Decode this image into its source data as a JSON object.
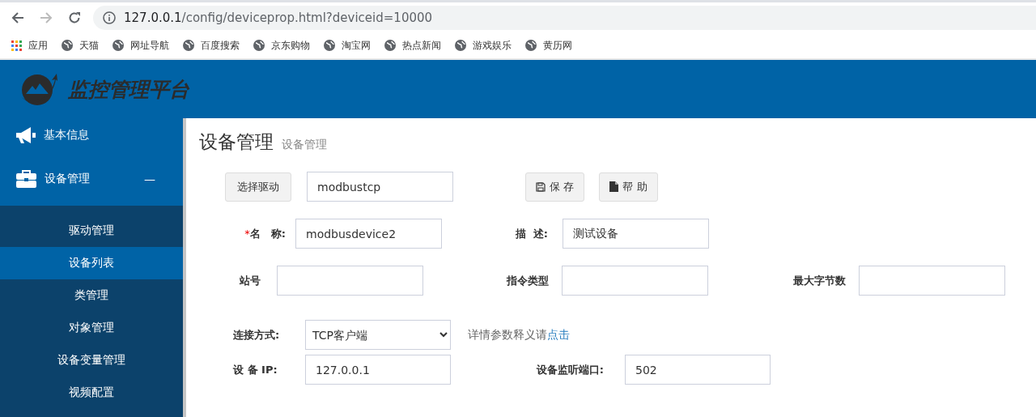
{
  "browser": {
    "nav_buttons": [
      {
        "kind": "back",
        "disabled": false
      },
      {
        "kind": "forward",
        "disabled": true
      },
      {
        "kind": "reload",
        "disabled": false
      }
    ],
    "url_host": "127.0.0.1",
    "url_path": "/config/deviceprop.html?deviceid=10000",
    "bookmarks": [
      {
        "kind": "apps",
        "label": "应用"
      },
      {
        "kind": "site",
        "label": "天猫"
      },
      {
        "kind": "site",
        "label": "网址导航"
      },
      {
        "kind": "site",
        "label": "百度搜索"
      },
      {
        "kind": "site",
        "label": "京东购物"
      },
      {
        "kind": "site",
        "label": "淘宝网"
      },
      {
        "kind": "site",
        "label": "热点新闻"
      },
      {
        "kind": "site",
        "label": "游戏娱乐"
      },
      {
        "kind": "site",
        "label": "黄历网"
      }
    ]
  },
  "header": {
    "title": "监控管理平台"
  },
  "sidebar": {
    "items": [
      {
        "kind": "megaphone",
        "label": "基本信息"
      },
      {
        "kind": "briefcase",
        "label": "设备管理",
        "expanded": true,
        "toggle": "—",
        "children": [
          {
            "label": "驱动管理",
            "selected": false
          },
          {
            "label": "设备列表",
            "selected": true
          },
          {
            "label": "类管理",
            "selected": false
          },
          {
            "label": "对象管理",
            "selected": false
          },
          {
            "label": "设备变量管理",
            "selected": false
          },
          {
            "label": "视频配置",
            "selected": false
          }
        ]
      }
    ]
  },
  "page": {
    "title": "设备管理",
    "subtitle": "设备管理"
  },
  "form": {
    "driver_button": "选择驱动",
    "driver_value": "modbustcp",
    "actions": [
      {
        "kind": "save",
        "label": "保 存"
      },
      {
        "kind": "help",
        "label": "帮 助"
      }
    ],
    "name": {
      "required_mark": "*",
      "label": "名　称:",
      "value": "modbusdevice2"
    },
    "description": {
      "label": "描  述:",
      "value": "测试设备"
    },
    "station": {
      "label": "站号"
    },
    "command_type": {
      "label": "指令类型"
    },
    "max_bytes": {
      "label": "最大字节数"
    },
    "connection": {
      "label": "连接方式:",
      "value": "TCP客户端",
      "note": "详情参数释义请",
      "link": "点击"
    },
    "device_ip": {
      "label": "设 备 IP:",
      "value": "127.0.0.1"
    },
    "listen_port": {
      "label": "设备监听端口:",
      "value": "502"
    }
  }
}
